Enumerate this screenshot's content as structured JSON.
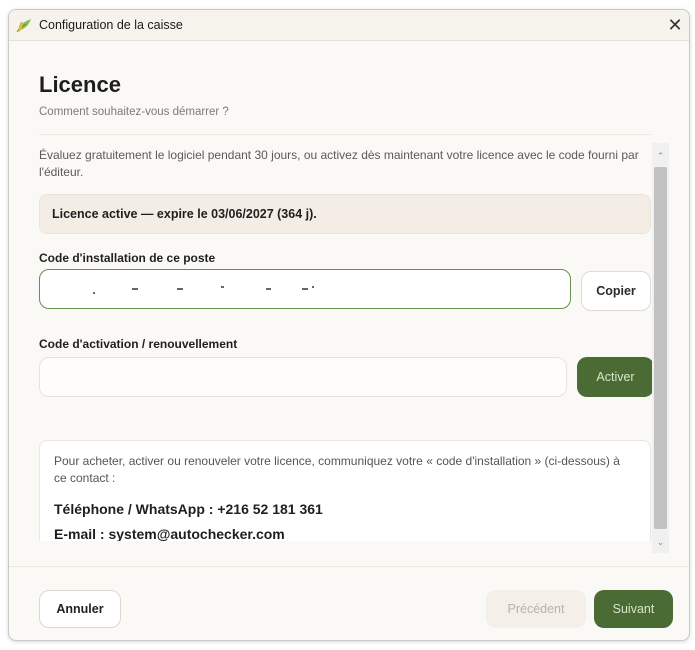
{
  "window": {
    "title": "Configuration de la caisse",
    "close_glyph": "✕",
    "app_icon": "leaf-icon"
  },
  "page": {
    "heading": "Licence",
    "subheading": "Comment souhaitez-vous démarrer ?",
    "intro": "Évaluez gratuitement le logiciel pendant 30 jours, ou activez dès maintenant votre licence avec le code fourni par l'éditeur.",
    "status": "Licence active — expire le 03/06/2027 (364 j).",
    "install_code_label": "Code d'installation de ce poste",
    "install_code_value": "",
    "copy_label": "Copier",
    "activation_label": "Code d'activation / renouvellement",
    "activation_value": "",
    "activate_label": "Activer",
    "contact_text": "Pour acheter, activer ou renouveler votre licence, communiquez votre « code d'installation » (ci-dessous) à ce contact :",
    "phone": "Téléphone / WhatsApp : +216 52 181 361",
    "email": "E-mail : system@autochecker.com"
  },
  "footer": {
    "cancel_label": "Annuler",
    "prev_label": "Précédent",
    "next_label": "Suivant"
  },
  "colors": {
    "accent": "#4a6b34",
    "accent_text": "#d8e6cc",
    "focus_border": "#6a8f4a"
  }
}
